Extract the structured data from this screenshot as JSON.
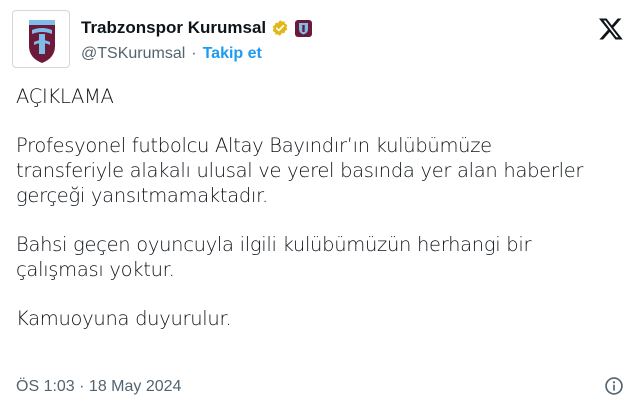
{
  "tweet": {
    "author_name": "Trabzonspor Kurumsal",
    "handle": "@TSKurumsal",
    "separator": "·",
    "follow_label": "Takip et",
    "paragraphs": [
      "AÇIKLAMA",
      "Profesyonel futbolcu Altay Bayındır’ın kulübümüze\ntransferiyle alakalı ulusal ve yerel basında yer alan haberler\ngerçeği yansıtmamaktadır.",
      "Bahsi geçen oyuncuyla ilgili kulübümüzün herhangi bir\nçalışması yoktur.",
      "Kamuoyuna duyurulur."
    ],
    "timestamp": "ÖS 1:03 · 18 May 2024"
  },
  "icons": {
    "avatar": "trabzonspor-logo",
    "verified": "verified-badge-icon",
    "affiliate": "trabzonspor-affiliate-badge",
    "platform": "x-logo-icon",
    "info": "info-icon"
  },
  "colors": {
    "claret": "#6d1a3a",
    "blue": "#1d9bf0",
    "gold": "#e2b719",
    "muted": "#536471"
  }
}
